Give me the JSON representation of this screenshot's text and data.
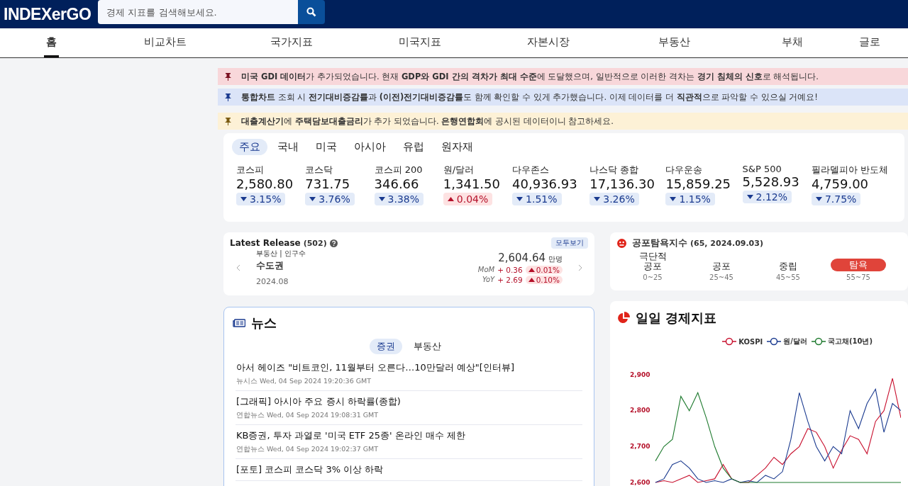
{
  "header": {
    "logo": "INDEXerGO",
    "search": {
      "placeholder": "경제 지표를 검색해보세요."
    }
  },
  "nav": [
    {
      "label": "홈",
      "selected": true
    },
    {
      "label": "비교차트",
      "selected": false
    },
    {
      "label": "국가지표",
      "selected": false
    },
    {
      "label": "미국지표",
      "selected": false
    },
    {
      "label": "자본시장",
      "selected": false
    },
    {
      "label": "부동산",
      "selected": false
    },
    {
      "label": "부채",
      "selected": false
    },
    {
      "label": "글로",
      "selected": false
    }
  ],
  "notices": [
    {
      "kind": "red",
      "text": "**미국 GDI 데이터**가 추가되었습니다. 현재 **GDP와 GDI 간의 격차가 최대 수준**에 도달했으며, 일반적으로 이러한 격차는 **경기 침체의 신호**로 해석됩니다."
    },
    {
      "kind": "blue",
      "text": "**통합차트** 조회 시 **전기대비증감률**과 **(이전)전기대비증감률**도 함께 확인할 수 있게 추가했습니다. 이제 데이터를 더 **직관적**으로 파악할 수 있으실 거예요!"
    },
    {
      "kind": "yellow",
      "text": "**대출계산기**에 **주택담보대출금리**가 추가 되었습니다. **은행연합회**에 공시된 데이터이니 참고하세요."
    }
  ],
  "market": {
    "tabs": [
      {
        "label": "주요",
        "selected": true
      },
      {
        "label": "국내",
        "selected": false
      },
      {
        "label": "미국",
        "selected": false
      },
      {
        "label": "아시아",
        "selected": false
      },
      {
        "label": "유럽",
        "selected": false
      },
      {
        "label": "원자재",
        "selected": false
      }
    ],
    "indices": [
      {
        "name": "코스피",
        "value": "2,580.80",
        "up": false,
        "change": "3.15%"
      },
      {
        "name": "코스닥",
        "value": "731.75",
        "up": false,
        "change": "3.76%"
      },
      {
        "name": "코스피 200",
        "value": "346.66",
        "up": false,
        "change": "3.38%"
      },
      {
        "name": "원/달러",
        "value": "1,341.50",
        "up": true,
        "change": "0.04%"
      },
      {
        "name": "다우존스",
        "value": "40,936.93",
        "up": false,
        "change": "1.51%"
      },
      {
        "name": "나스닥 종합",
        "value": "17,136.30",
        "up": false,
        "change": "3.26%"
      },
      {
        "name": "다우운송",
        "value": "15,859.25",
        "up": false,
        "change": "1.15%"
      },
      {
        "name": "S&P 500",
        "value": "5,528.93",
        "up": false,
        "change": "2.12%"
      },
      {
        "name": "필라델피아 반도체",
        "value": "4,759.00",
        "up": false,
        "change": "7.75%"
      }
    ]
  },
  "latest_release": {
    "title": "Latest Release",
    "count": "(502)",
    "view_all": "모두보기",
    "item": {
      "category": "부동산 | 인구수",
      "name": "수도권",
      "date": "2024.08",
      "value": "2,604.64",
      "unit": "만명",
      "rows": [
        {
          "label": "MoM",
          "diff": "+ 0.36",
          "up": true,
          "change": "0.01%"
        },
        {
          "label": "YoY",
          "diff": "+ 2.69",
          "up": true,
          "change": "0.10%"
        }
      ]
    }
  },
  "fear_greed": {
    "title": "공포탐욕지수",
    "detail": "(65, 2024.09.03)",
    "levels": [
      {
        "label": "극단적\n공포",
        "range": "0~25",
        "selected": false
      },
      {
        "label": "공포",
        "range": "25~45",
        "selected": false
      },
      {
        "label": "중립",
        "range": "45~55",
        "selected": false
      },
      {
        "label": "탐욕",
        "range": "55~75",
        "selected": true
      }
    ]
  },
  "news": {
    "title": "뉴스",
    "tabs": [
      {
        "label": "증권",
        "selected": true
      },
      {
        "label": "부동산",
        "selected": false
      }
    ],
    "items": [
      {
        "headline": "아서 헤이즈 \"비트코인, 11월부터 오른다…10만달러 예상\"[인터뷰]",
        "source": "뉴시스",
        "time": "Wed, 04 Sep 2024 19:20:36 GMT"
      },
      {
        "headline": "[그래픽] 아시아 주요 증시 하락률(종합)",
        "source": "연합뉴스",
        "time": "Wed, 04 Sep 2024 19:08:31 GMT"
      },
      {
        "headline": "KB증권, 투자 과열로 '미국 ETF 25종' 온라인 매수 제한",
        "source": "연합뉴스",
        "time": "Wed, 04 Sep 2024 19:02:37 GMT"
      },
      {
        "headline": "[포토] 코스피 코스닥 3% 이상 하락"
      }
    ]
  },
  "daily_chart": {
    "title": "일일 경제지표",
    "chart_data": {
      "type": "line",
      "categories": [
        null,
        null,
        null,
        null,
        null,
        null,
        null,
        null,
        null,
        null,
        null,
        null,
        null,
        null,
        null,
        null,
        null,
        null,
        null,
        null,
        null,
        null,
        null,
        null,
        null,
        null,
        null,
        null,
        null,
        null
      ],
      "ylim": [
        2600,
        2900
      ],
      "yticks": [
        {
          "value": 2900,
          "label": "2,900"
        },
        {
          "value": 2800,
          "label": "2,800"
        },
        {
          "value": 2700,
          "label": "2,700"
        },
        {
          "value": 2600,
          "label": "2,600"
        }
      ],
      "series": [
        {
          "name": "KOSPI",
          "color": "#c8102e",
          "values": [
            2600,
            2605,
            2600,
            2610,
            2620,
            2600,
            2605,
            2610,
            2650,
            2610,
            2600,
            2600,
            2620,
            2640,
            2670,
            2650,
            2680,
            2700,
            2750,
            2740,
            2700,
            2640,
            2690,
            2730,
            2720,
            2680,
            2770,
            2800,
            2890,
            2780
          ]
        },
        {
          "name": "원/달러",
          "color": "#1a3a8f",
          "values": [
            2600,
            2610,
            2650,
            2660,
            2640,
            2610,
            2600,
            2605,
            2600,
            2610,
            2600,
            2605,
            2600,
            2620,
            2610,
            2630,
            2720,
            2850,
            2770,
            2700,
            2660,
            2700,
            2680,
            2800,
            2750,
            2820,
            2860,
            2740,
            2820,
            2800
          ]
        },
        {
          "name": "국고채(10년)",
          "color": "#1e7a2e",
          "values": [
            2660,
            2700,
            2720,
            2840,
            2800,
            2850,
            2780,
            2700,
            2640,
            2610,
            2600,
            2600,
            2600,
            2600,
            2600,
            2600,
            2600,
            2600,
            2600,
            2600,
            2600,
            2600,
            2600,
            2600,
            2600,
            2600,
            2600,
            2600,
            2600,
            2600
          ]
        }
      ]
    }
  }
}
